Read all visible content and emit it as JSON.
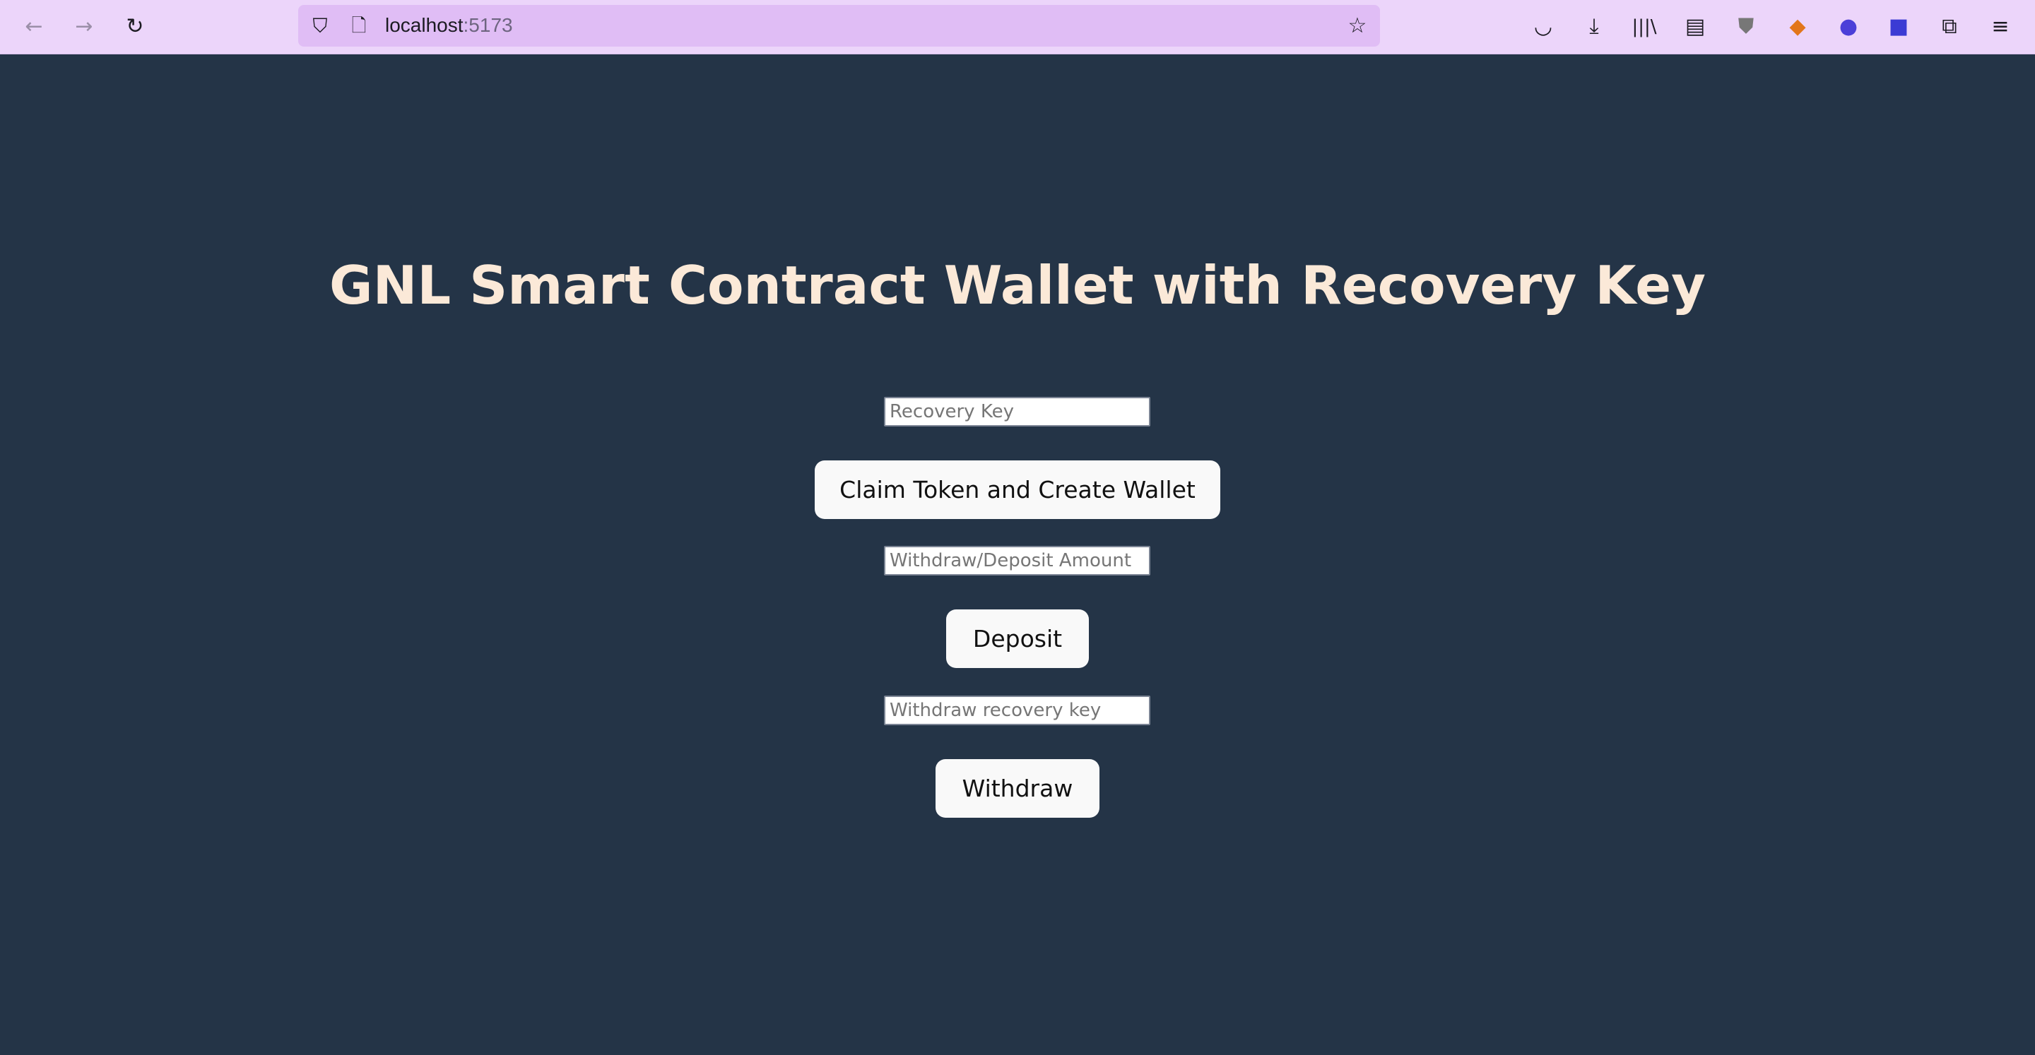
{
  "browser": {
    "url_host": "localhost",
    "url_port": ":5173",
    "icons": [
      "back-icon",
      "forward-icon",
      "reload-icon",
      "shield-icon",
      "page-icon",
      "bookmark-star-icon",
      "pocket-icon",
      "download-icon",
      "library-icon",
      "sidebar-icon",
      "ublock-icon",
      "metamask-icon",
      "extension-icon",
      "extension-a-icon",
      "extensions-puzzle-icon",
      "menu-icon"
    ]
  },
  "page": {
    "title": "GNL Smart Contract Wallet with Recovery Key",
    "recovery_key_placeholder": "Recovery Key",
    "claim_button": "Claim Token and Create Wallet",
    "amount_placeholder": "Withdraw/Deposit Amount",
    "deposit_button": "Deposit",
    "withdraw_key_placeholder": "Withdraw recovery key",
    "withdraw_button": "Withdraw"
  },
  "colors": {
    "background": "#243447",
    "title": "#fbe9d8",
    "toolbar": "#ecd5fa"
  }
}
